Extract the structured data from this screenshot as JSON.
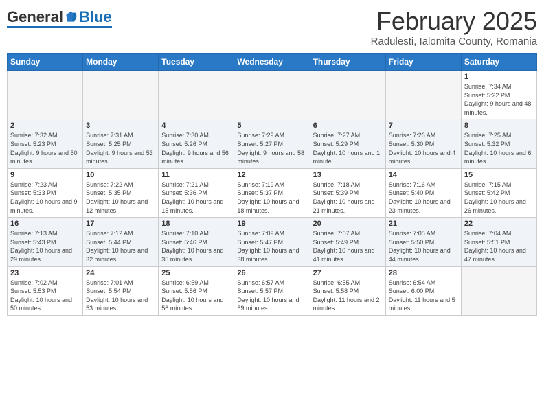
{
  "header": {
    "logo": {
      "general": "General",
      "blue": "Blue"
    },
    "title": "February 2025",
    "location": "Radulesti, Ialomita County, Romania"
  },
  "calendar": {
    "headers": [
      "Sunday",
      "Monday",
      "Tuesday",
      "Wednesday",
      "Thursday",
      "Friday",
      "Saturday"
    ],
    "rows": [
      {
        "cells": [
          {
            "day": "",
            "info": "",
            "empty": true
          },
          {
            "day": "",
            "info": "",
            "empty": true
          },
          {
            "day": "",
            "info": "",
            "empty": true
          },
          {
            "day": "",
            "info": "",
            "empty": true
          },
          {
            "day": "",
            "info": "",
            "empty": true
          },
          {
            "day": "",
            "info": "",
            "empty": true
          },
          {
            "day": "1",
            "info": "Sunrise: 7:34 AM\nSunset: 5:22 PM\nDaylight: 9 hours and 48 minutes.",
            "empty": false
          }
        ]
      },
      {
        "cells": [
          {
            "day": "2",
            "info": "Sunrise: 7:32 AM\nSunset: 5:23 PM\nDaylight: 9 hours and 50 minutes.",
            "empty": false
          },
          {
            "day": "3",
            "info": "Sunrise: 7:31 AM\nSunset: 5:25 PM\nDaylight: 9 hours and 53 minutes.",
            "empty": false
          },
          {
            "day": "4",
            "info": "Sunrise: 7:30 AM\nSunset: 5:26 PM\nDaylight: 9 hours and 56 minutes.",
            "empty": false
          },
          {
            "day": "5",
            "info": "Sunrise: 7:29 AM\nSunset: 5:27 PM\nDaylight: 9 hours and 58 minutes.",
            "empty": false
          },
          {
            "day": "6",
            "info": "Sunrise: 7:27 AM\nSunset: 5:29 PM\nDaylight: 10 hours and 1 minute.",
            "empty": false
          },
          {
            "day": "7",
            "info": "Sunrise: 7:26 AM\nSunset: 5:30 PM\nDaylight: 10 hours and 4 minutes.",
            "empty": false
          },
          {
            "day": "8",
            "info": "Sunrise: 7:25 AM\nSunset: 5:32 PM\nDaylight: 10 hours and 6 minutes.",
            "empty": false
          }
        ]
      },
      {
        "cells": [
          {
            "day": "9",
            "info": "Sunrise: 7:23 AM\nSunset: 5:33 PM\nDaylight: 10 hours and 9 minutes.",
            "empty": false
          },
          {
            "day": "10",
            "info": "Sunrise: 7:22 AM\nSunset: 5:35 PM\nDaylight: 10 hours and 12 minutes.",
            "empty": false
          },
          {
            "day": "11",
            "info": "Sunrise: 7:21 AM\nSunset: 5:36 PM\nDaylight: 10 hours and 15 minutes.",
            "empty": false
          },
          {
            "day": "12",
            "info": "Sunrise: 7:19 AM\nSunset: 5:37 PM\nDaylight: 10 hours and 18 minutes.",
            "empty": false
          },
          {
            "day": "13",
            "info": "Sunrise: 7:18 AM\nSunset: 5:39 PM\nDaylight: 10 hours and 21 minutes.",
            "empty": false
          },
          {
            "day": "14",
            "info": "Sunrise: 7:16 AM\nSunset: 5:40 PM\nDaylight: 10 hours and 23 minutes.",
            "empty": false
          },
          {
            "day": "15",
            "info": "Sunrise: 7:15 AM\nSunset: 5:42 PM\nDaylight: 10 hours and 26 minutes.",
            "empty": false
          }
        ]
      },
      {
        "cells": [
          {
            "day": "16",
            "info": "Sunrise: 7:13 AM\nSunset: 5:43 PM\nDaylight: 10 hours and 29 minutes.",
            "empty": false
          },
          {
            "day": "17",
            "info": "Sunrise: 7:12 AM\nSunset: 5:44 PM\nDaylight: 10 hours and 32 minutes.",
            "empty": false
          },
          {
            "day": "18",
            "info": "Sunrise: 7:10 AM\nSunset: 5:46 PM\nDaylight: 10 hours and 35 minutes.",
            "empty": false
          },
          {
            "day": "19",
            "info": "Sunrise: 7:09 AM\nSunset: 5:47 PM\nDaylight: 10 hours and 38 minutes.",
            "empty": false
          },
          {
            "day": "20",
            "info": "Sunrise: 7:07 AM\nSunset: 5:49 PM\nDaylight: 10 hours and 41 minutes.",
            "empty": false
          },
          {
            "day": "21",
            "info": "Sunrise: 7:05 AM\nSunset: 5:50 PM\nDaylight: 10 hours and 44 minutes.",
            "empty": false
          },
          {
            "day": "22",
            "info": "Sunrise: 7:04 AM\nSunset: 5:51 PM\nDaylight: 10 hours and 47 minutes.",
            "empty": false
          }
        ]
      },
      {
        "cells": [
          {
            "day": "23",
            "info": "Sunrise: 7:02 AM\nSunset: 5:53 PM\nDaylight: 10 hours and 50 minutes.",
            "empty": false
          },
          {
            "day": "24",
            "info": "Sunrise: 7:01 AM\nSunset: 5:54 PM\nDaylight: 10 hours and 53 minutes.",
            "empty": false
          },
          {
            "day": "25",
            "info": "Sunrise: 6:59 AM\nSunset: 5:56 PM\nDaylight: 10 hours and 56 minutes.",
            "empty": false
          },
          {
            "day": "26",
            "info": "Sunrise: 6:57 AM\nSunset: 5:57 PM\nDaylight: 10 hours and 59 minutes.",
            "empty": false
          },
          {
            "day": "27",
            "info": "Sunrise: 6:55 AM\nSunset: 5:58 PM\nDaylight: 11 hours and 2 minutes.",
            "empty": false
          },
          {
            "day": "28",
            "info": "Sunrise: 6:54 AM\nSunset: 6:00 PM\nDaylight: 11 hours and 5 minutes.",
            "empty": false
          },
          {
            "day": "",
            "info": "",
            "empty": true
          }
        ]
      }
    ]
  }
}
